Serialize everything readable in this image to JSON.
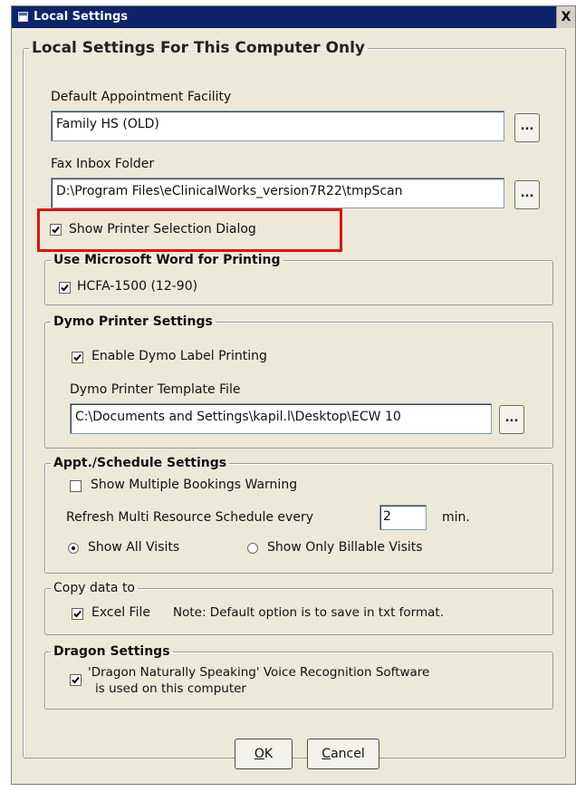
{
  "window": {
    "title": "Local Settings",
    "close_glyph": "X"
  },
  "main_group": {
    "legend": "Local Settings For This Computer Only"
  },
  "default_facility": {
    "label": "Default Appointment Facility",
    "value": "Family HS (OLD)",
    "browse_label": "..."
  },
  "fax_inbox": {
    "label": "Fax Inbox Folder",
    "value": "D:\\Program Files\\eClinicalWorks_version7R22\\tmpScan",
    "browse_label": "..."
  },
  "printer_dialog": {
    "label": "Show Printer Selection Dialog",
    "checked": true
  },
  "ms_word": {
    "legend": "Use Microsoft Word for Printing",
    "hcfa": {
      "label": "HCFA-1500 (12-90)",
      "checked": true
    }
  },
  "dymo": {
    "legend": "Dymo Printer Settings",
    "enable": {
      "label": "Enable Dymo Label Printing",
      "checked": true
    },
    "template_label": "Dymo Printer Template File",
    "template_value": "C:\\Documents and Settings\\kapil.l\\Desktop\\ECW 10",
    "browse_label": "..."
  },
  "schedule": {
    "legend": "Appt./Schedule Settings",
    "multiple_bookings": {
      "label": "Show Multiple Bookings Warning",
      "checked": false
    },
    "refresh_prefix": "Refresh Multi Resource Schedule every",
    "refresh_value": "2",
    "refresh_suffix": "min.",
    "radio_all": {
      "label": "Show All Visits",
      "selected": true
    },
    "radio_billable": {
      "label": "Show Only Billable Visits",
      "selected": false
    }
  },
  "copy_data": {
    "legend": "Copy data to",
    "excel": {
      "label": "Excel File",
      "checked": true
    },
    "note": "Note: Default option is to save in txt format."
  },
  "dragon": {
    "legend": "Dragon Settings",
    "option": {
      "label_line1": "'Dragon Naturally Speaking' Voice Recognition Software",
      "label_line2": "is used on this computer",
      "checked": true
    }
  },
  "buttons": {
    "ok_underlined": "O",
    "ok_rest": "K",
    "cancel_underlined": "C",
    "cancel_rest": "ancel"
  },
  "colors": {
    "titlebar": "#0b246a",
    "dialog_background": "#ece9d8",
    "highlight_box": "#e21010"
  }
}
